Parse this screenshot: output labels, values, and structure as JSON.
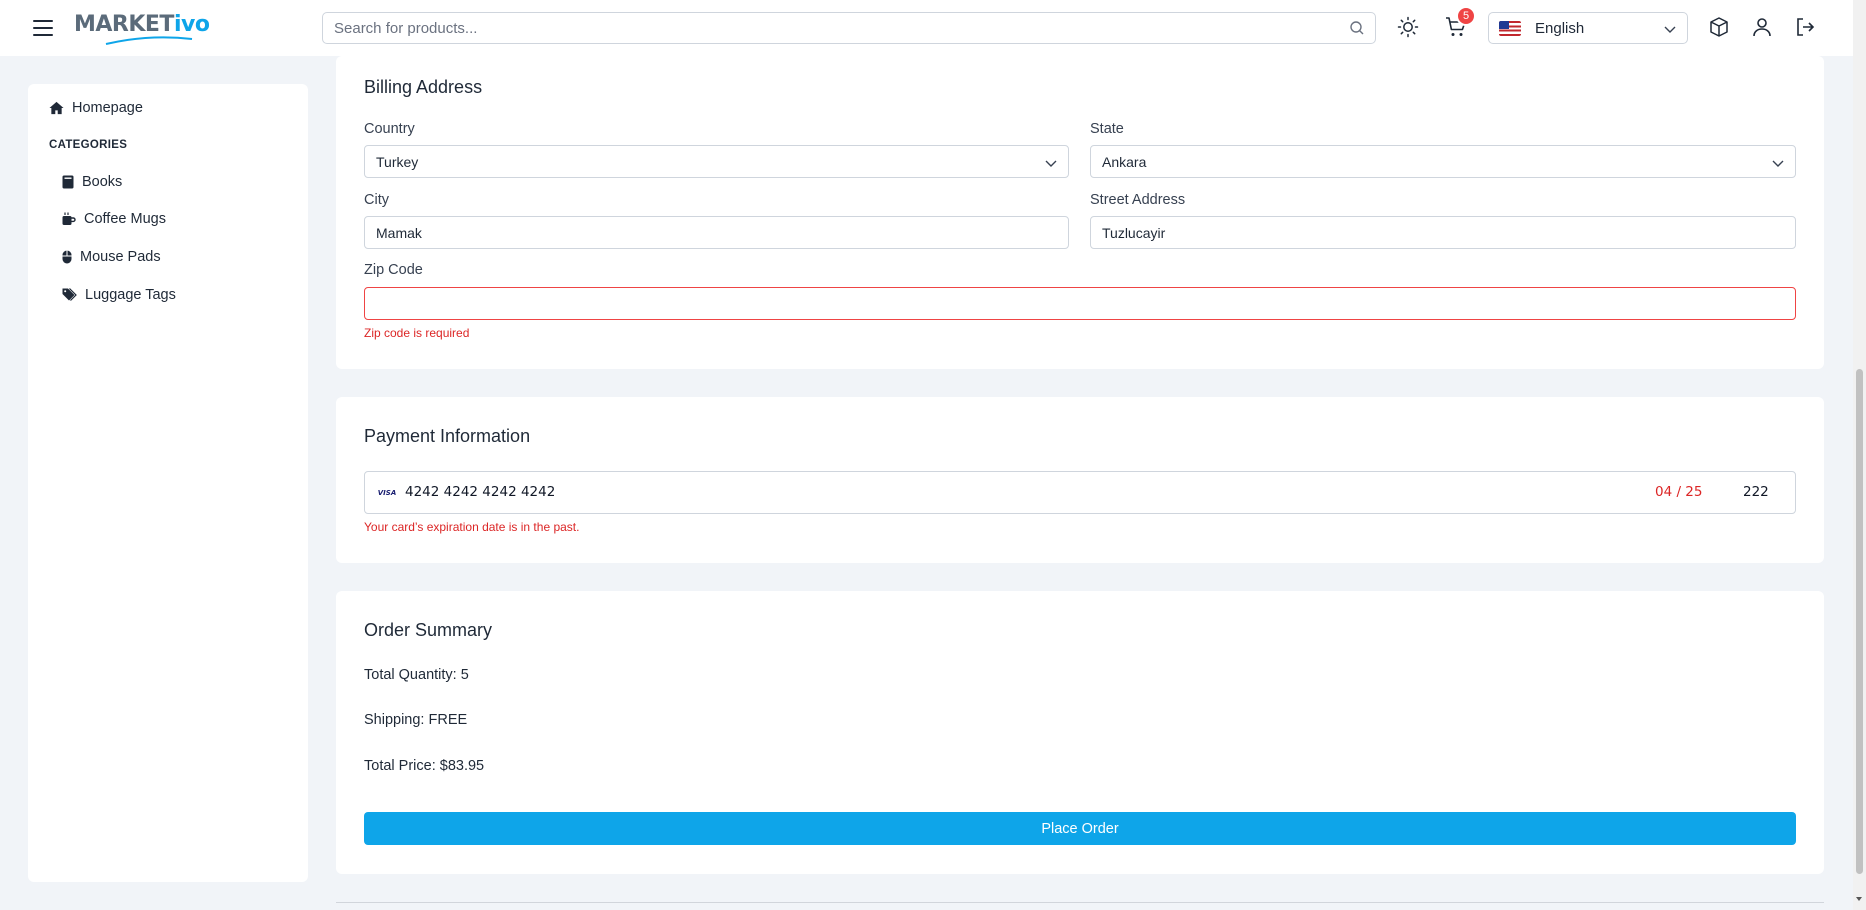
{
  "header": {
    "logo_main": "MARKET",
    "logo_accent": "ivo",
    "search_placeholder": "Search for products...",
    "cart_count": "5",
    "language": "English"
  },
  "sidebar": {
    "homepage_label": "Homepage",
    "categories_title": "CATEGORIES",
    "categories": [
      {
        "label": "Books",
        "icon": "book-icon"
      },
      {
        "label": "Coffee Mugs",
        "icon": "mug-icon"
      },
      {
        "label": "Mouse Pads",
        "icon": "mouse-icon"
      },
      {
        "label": "Luggage Tags",
        "icon": "tags-icon"
      }
    ]
  },
  "billing": {
    "title": "Billing Address",
    "country_label": "Country",
    "country_value": "Turkey",
    "state_label": "State",
    "state_value": "Ankara",
    "city_label": "City",
    "city_value": "Mamak",
    "street_label": "Street Address",
    "street_value": "Tuzlucayir",
    "zip_label": "Zip Code",
    "zip_value": "",
    "zip_error": "Zip code is required"
  },
  "payment": {
    "title": "Payment Information",
    "card_brand": "VISA",
    "card_number": "4242 4242 4242 4242",
    "card_expiry": "04 / 25",
    "card_cvc": "222",
    "error": "Your card’s expiration date is in the past."
  },
  "summary": {
    "title": "Order Summary",
    "quantity_label": "Total Quantity:",
    "quantity_value": "5",
    "shipping_label": "Shipping:",
    "shipping_value": "FREE",
    "price_label": "Total Price:",
    "price_value": "$83.95",
    "place_order": "Place Order"
  },
  "colors": {
    "accent": "#0ea5e9",
    "error": "#dc2626",
    "badge": "#ef4444",
    "background": "#f1f4f8"
  }
}
